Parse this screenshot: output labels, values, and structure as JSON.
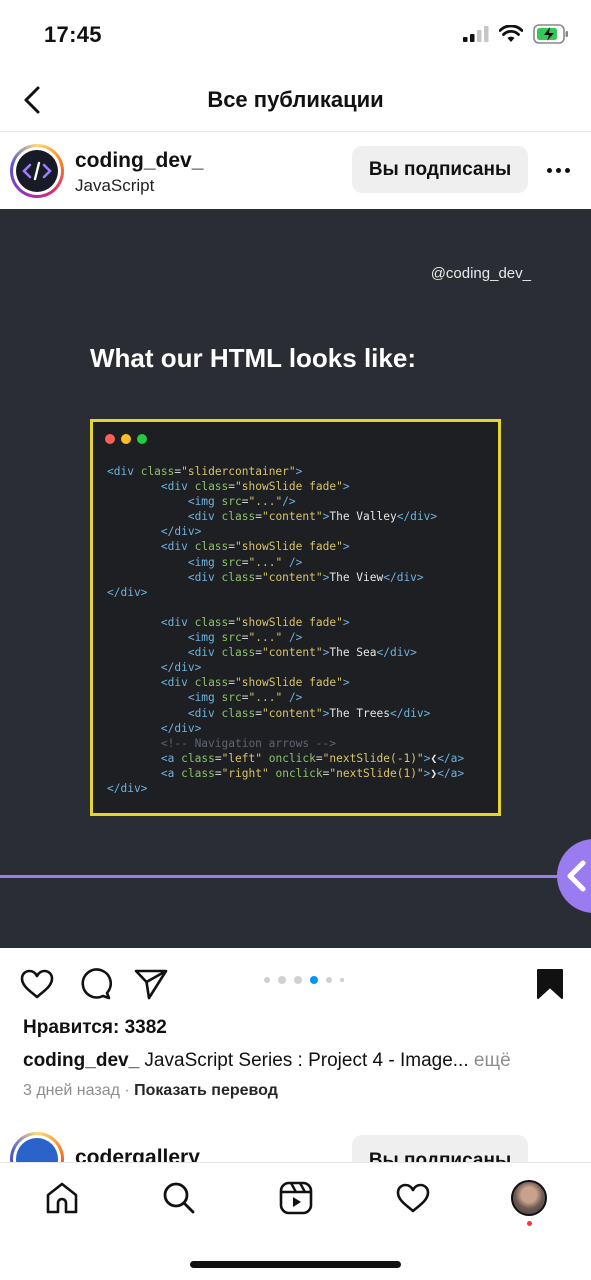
{
  "status_bar": {
    "time": "17:45"
  },
  "header": {
    "title": "Все публикации"
  },
  "post": {
    "username": "coding_dev_",
    "subtitle": "JavaScript",
    "follow_label": "Вы подписаны",
    "image": {
      "watermark": "@coding_dev_",
      "heading": "What our HTML looks like:"
    },
    "likes": "Нравится: 3382",
    "caption_user": "coding_dev_",
    "caption_text": " JavaScript Series : Project 4 - Image... ",
    "caption_more": "ещё",
    "time_ago": "3 дней назад",
    "separator": " · ",
    "translate": "Показать перевод"
  },
  "next_post": {
    "username": "codergallery",
    "follow_label": "Вы подписаны"
  },
  "colors": {
    "accent_purple": "#9b7cf0",
    "code_border": "#e4d62e",
    "image_bg": "#2b2d34",
    "notification": "#ff3040"
  },
  "icons": [
    "back-icon",
    "more-icon",
    "heart-icon",
    "comment-icon",
    "share-icon",
    "bookmark-icon",
    "home-icon",
    "search-icon",
    "reels-icon",
    "activity-icon"
  ]
}
